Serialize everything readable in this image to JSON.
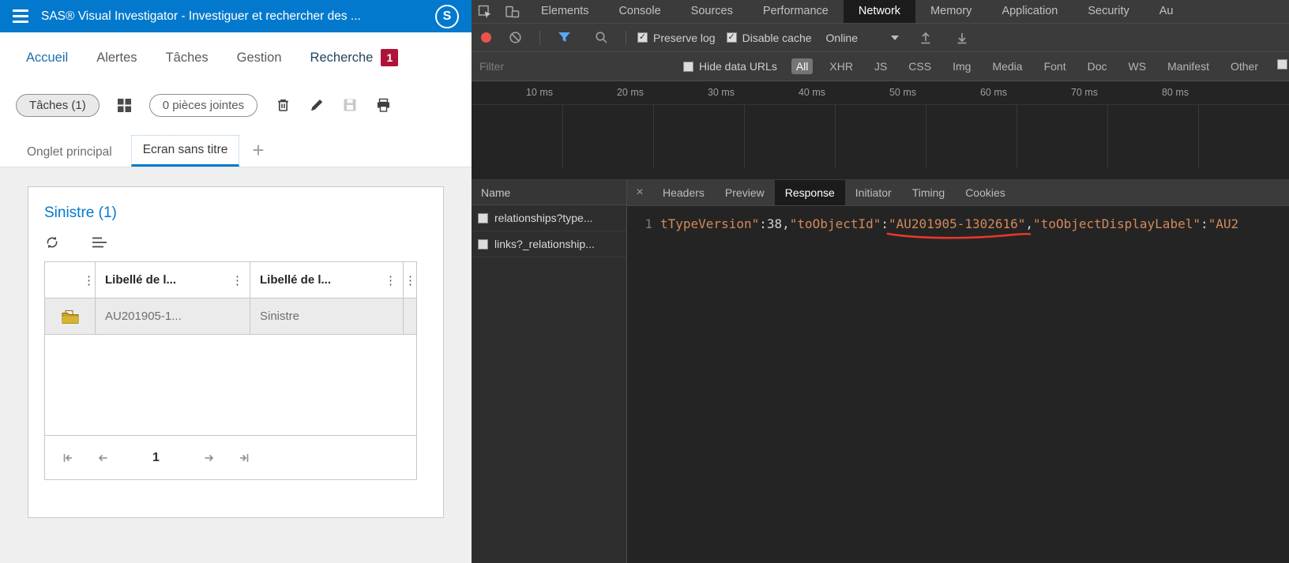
{
  "colors": {
    "accent_blue": "#0379cd",
    "badge_red": "#b01339",
    "record_red": "#e9544e",
    "funnel_blue": "#56aaf2",
    "code_orange": "#d2895a",
    "annotation_red": "#e8382a",
    "folder_gold": "#c9a227",
    "devtools_bg": "#3b3b3b"
  },
  "app": {
    "header": {
      "title": "SAS® Visual Investigator - Investiguer et rechercher des ...",
      "logo": "S"
    },
    "nav": {
      "items": [
        {
          "label": "Accueil"
        },
        {
          "label": "Alertes"
        },
        {
          "label": "Tâches"
        },
        {
          "label": "Gestion"
        },
        {
          "label": "Recherche"
        }
      ],
      "badge": "1"
    },
    "toolbar": {
      "tasks_label": "Tâches (1)",
      "attachments_label": "0 pièces jointes"
    },
    "tabs": {
      "main_tab": "Onglet principal",
      "active_tab": "Ecran sans titre",
      "add": "+"
    },
    "panel": {
      "title": "Sinistre (1)",
      "table": {
        "kebab_icon": "⋮",
        "columns": [
          "Libellé de l...",
          "Libellé de l..."
        ],
        "row": {
          "cells": [
            "AU201905-1...",
            "Sinistre"
          ]
        },
        "pagination": {
          "page": "1"
        }
      }
    }
  },
  "devtools": {
    "tabs": [
      "Elements",
      "Console",
      "Sources",
      "Performance",
      "Network",
      "Memory",
      "Application",
      "Security",
      "Au"
    ],
    "active_tab": "Network",
    "controls": {
      "preserve_log": "Preserve log",
      "disable_cache": "Disable cache",
      "throttling": "Online",
      "check_mark": "✓"
    },
    "filter": {
      "placeholder": "Filter",
      "hide_data_urls": "Hide data URLs",
      "chips": [
        "All",
        "XHR",
        "JS",
        "CSS",
        "Img",
        "Media",
        "Font",
        "Doc",
        "WS",
        "Manifest",
        "Other"
      ],
      "active_chip": "All"
    },
    "timeline": {
      "labels": [
        "10 ms",
        "20 ms",
        "30 ms",
        "40 ms",
        "50 ms",
        "60 ms",
        "70 ms",
        "80 ms"
      ]
    },
    "requests": {
      "header": "Name",
      "rows": [
        "relationships?type...",
        "links?_relationship..."
      ]
    },
    "detail": {
      "close": "×",
      "tabs": [
        "Headers",
        "Preview",
        "Response",
        "Initiator",
        "Timing",
        "Cookies"
      ],
      "active_tab": "Response"
    },
    "response": {
      "line_number": "1",
      "tokens": [
        {
          "text": "tTypeVersion\"",
          "type": "string"
        },
        {
          "text": ":",
          "type": "punct"
        },
        {
          "text": "38",
          "type": "number"
        },
        {
          "text": ",",
          "type": "punct"
        },
        {
          "text": "\"toObjectId\"",
          "type": "string"
        },
        {
          "text": ":",
          "type": "punct"
        },
        {
          "text": "\"AU201905-1302616\"",
          "type": "string",
          "underline": true
        },
        {
          "text": ",",
          "type": "punct"
        },
        {
          "text": "\"toObjectDisplayLabel\"",
          "type": "string"
        },
        {
          "text": ":",
          "type": "punct"
        },
        {
          "text": "\"AU2",
          "type": "string"
        }
      ]
    }
  }
}
